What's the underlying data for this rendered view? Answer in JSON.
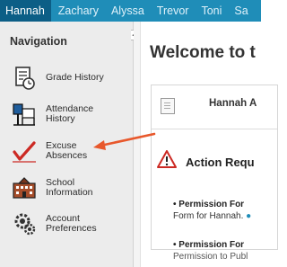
{
  "tabs": [
    "Hannah",
    "Zachary",
    "Alyssa",
    "Trevor",
    "Toni",
    "Sa"
  ],
  "sidebar": {
    "title": "Navigation",
    "items": [
      {
        "label": [
          "Grade History"
        ],
        "icon": "grade-history-icon"
      },
      {
        "label": [
          "Attendance",
          "History"
        ],
        "icon": "attendance-history-icon"
      },
      {
        "label": [
          "Excuse",
          "Absences"
        ],
        "icon": "excuse-absences-checkmark-icon"
      },
      {
        "label": [
          "School",
          "Information"
        ],
        "icon": "school-building-icon"
      },
      {
        "label": [
          "Account",
          "Preferences"
        ],
        "icon": "account-preferences-icon"
      }
    ]
  },
  "main": {
    "welcome": "Welcome to t",
    "card_name": "Hannah A",
    "action_title": "Action Requ",
    "perm1_title": "• Permission For",
    "perm1_text": "Form for Hannah.",
    "perm2_title": "• Permission For",
    "perm2_text": "Permission to Publ"
  },
  "colors": {
    "tab_bar": "#1f8db8",
    "tab_active": "#0c5e86",
    "arrow": "#e8582c",
    "warning": "#cc2a24"
  }
}
